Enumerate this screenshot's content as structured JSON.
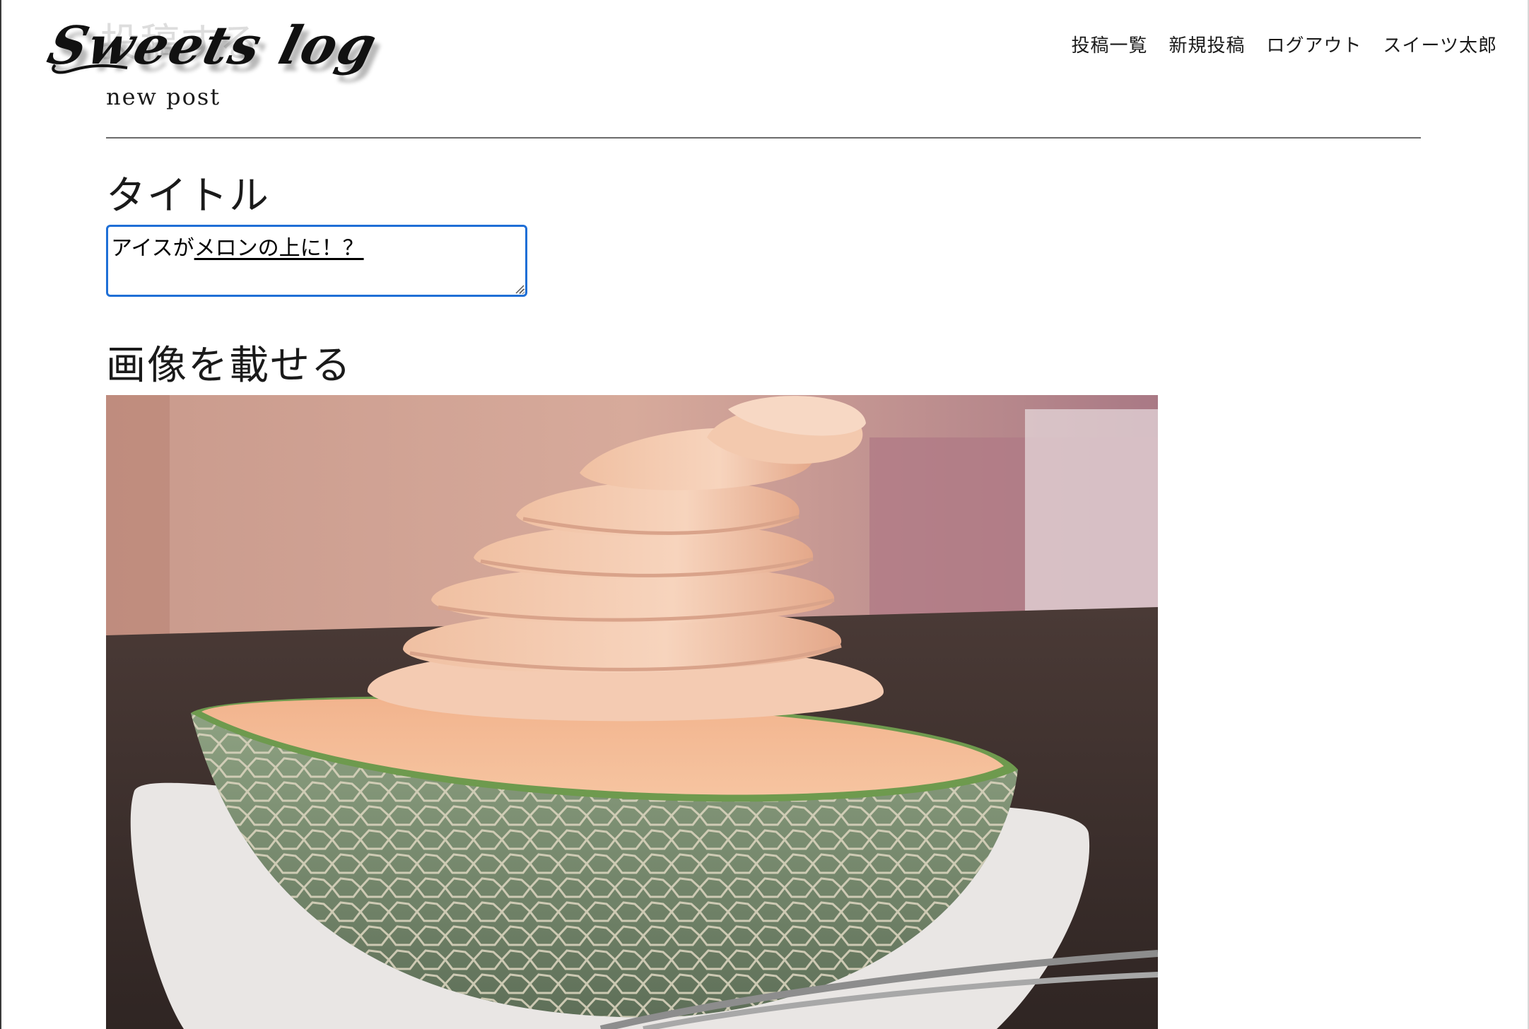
{
  "header": {
    "logo_text": "Sweets log",
    "logo_ghost_text": "投稿する",
    "nav": [
      {
        "label": "投稿一覧"
      },
      {
        "label": "新規投稿"
      },
      {
        "label": "ログアウト"
      },
      {
        "label": "スイーツ太郎"
      }
    ]
  },
  "page": {
    "subtitle": "new post"
  },
  "form": {
    "title_label": "タイトル",
    "title_value_plain": "アイスが",
    "title_value_underlined": "メロンの上に！？",
    "image_label": "画像を載せる"
  },
  "photo": {
    "icon": "uploaded-photo-melon-soft-serve"
  },
  "colors": {
    "focus_border": "#1f6fd6",
    "divider": "#6b6b6b"
  }
}
